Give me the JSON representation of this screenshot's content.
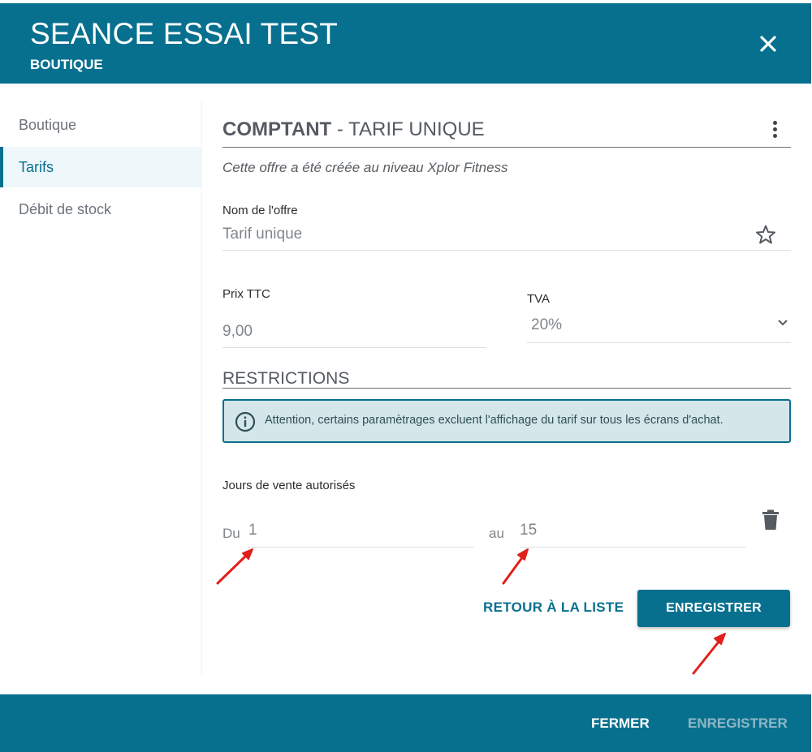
{
  "header": {
    "title": "SEANCE ESSAI TEST",
    "subtitle": "BOUTIQUE",
    "close_icon": "close-icon"
  },
  "sidebar": {
    "items": [
      {
        "label": "Boutique",
        "active": false
      },
      {
        "label": "Tarifs",
        "active": true
      },
      {
        "label": "Débit de stock",
        "active": false
      }
    ]
  },
  "offer": {
    "title_bold": "COMPTANT",
    "title_rest": " - TARIF UNIQUE",
    "origin_note": "Cette offre a été créée au niveau Xplor Fitness",
    "name_label": "Nom de l'offre",
    "name_value": "Tarif unique",
    "price_label": "Prix TTC",
    "price_value": "9,00",
    "vat_label": "TVA",
    "vat_value": "20%"
  },
  "restrictions": {
    "title": "RESTRICTIONS",
    "alert_text": "Attention, certains paramètrages excluent l'affichage du tarif sur tous les écrans d'achat.",
    "sale_days_label": "Jours de vente autorisés",
    "from_label": "Du",
    "from_value": "1",
    "to_label": "au",
    "to_value": "15"
  },
  "actions": {
    "back_label": "RETOUR À LA LISTE",
    "save_label": "ENREGISTRER"
  },
  "footer": {
    "close_label": "FERMER",
    "save_label": "ENREGISTRER"
  },
  "colors": {
    "brand": "#08708f",
    "alert_bg": "#d4e6ea",
    "annotation_arrow": "#e0201b"
  }
}
